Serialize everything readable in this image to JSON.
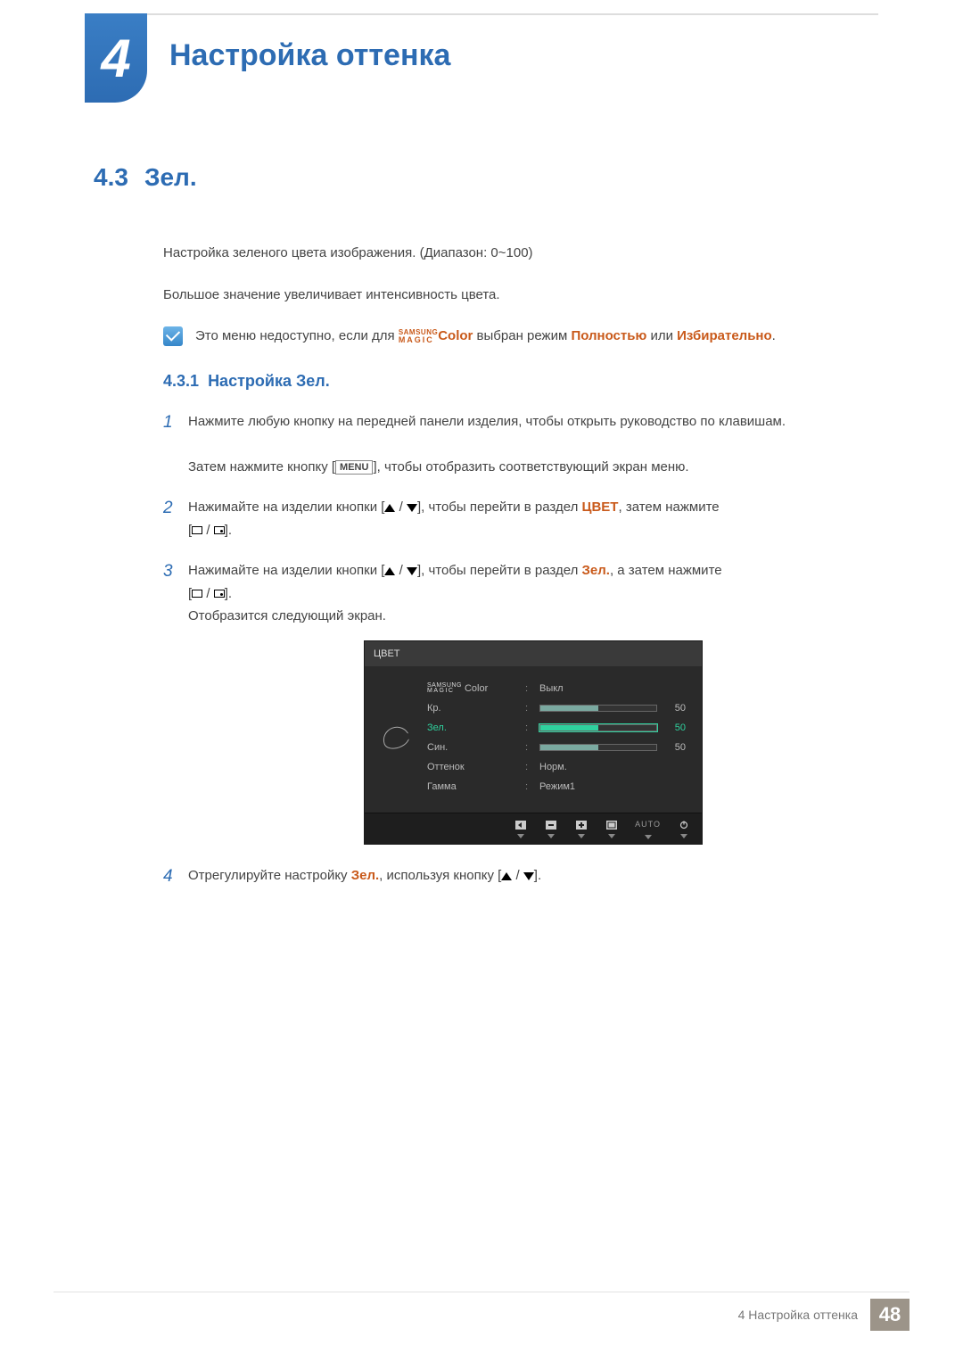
{
  "header": {
    "chapter_number": "4",
    "chapter_title": "Настройка оттенка"
  },
  "section": {
    "number": "4.3",
    "title": "Зел."
  },
  "intro": {
    "p1": "Настройка зеленого цвета изображения. (Диапазон: 0~100)",
    "p2": "Большое значение увеличивает интенсивность цвета."
  },
  "note": {
    "prefix": "Это меню недоступно, если для ",
    "magic_top": "SAMSUNG",
    "magic_bottom": "MAGIC",
    "color_word": "Color",
    "mid": " выбран режим ",
    "opt1": "Полностью",
    "or": " или ",
    "opt2": "Избирательно",
    "suffix": "."
  },
  "subsection": {
    "number": "4.3.1",
    "title": "Настройка Зел."
  },
  "steps": {
    "s1a": "Нажмите любую кнопку на передней панели изделия, чтобы открыть руководство по клавишам.",
    "s1b_pre": "Затем нажмите кнопку [",
    "s1b_menu": "MENU",
    "s1b_post": "], чтобы отобразить соответствующий экран меню.",
    "s2_pre": "Нажимайте на изделии кнопки [",
    "s2_mid": "], чтобы перейти в раздел ",
    "s2_target": "ЦВЕТ",
    "s2_post": ", затем нажмите",
    "s3_pre": "Нажимайте на изделии кнопки [",
    "s3_mid": "], чтобы перейти в раздел ",
    "s3_target": "Зел.",
    "s3_post": ", а затем нажмите",
    "s3_after": "Отобразится следующий экран.",
    "s4_pre": "Отрегулируйте настройку ",
    "s4_target": "Зел.",
    "s4_mid": ", используя кнопку [",
    "s4_post": "]."
  },
  "osd": {
    "title": "ЦВЕТ",
    "rows": {
      "magic_top": "SAMSUNG",
      "magic_bottom": "MAGIC",
      "magic_suffix": " Color",
      "magic_val": "Выкл",
      "red_label": "Кр.",
      "red_val": "50",
      "green_label": "Зел.",
      "green_val": "50",
      "blue_label": "Син.",
      "blue_val": "50",
      "tone_label": "Оттенок",
      "tone_val": "Норм.",
      "gamma_label": "Гамма",
      "gamma_val": "Режим1"
    },
    "footer_auto": "AUTO"
  },
  "footer": {
    "text": "4 Настройка оттенка",
    "page": "48"
  }
}
